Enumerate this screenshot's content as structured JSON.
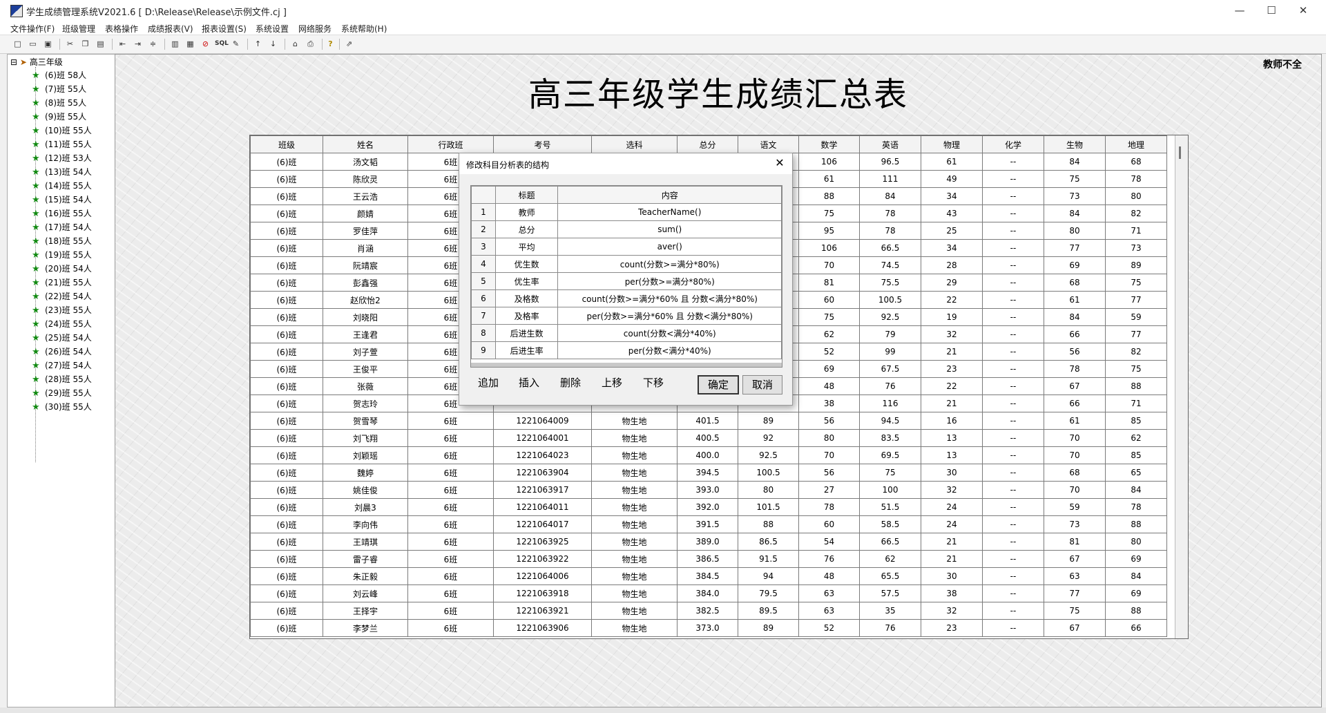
{
  "window": {
    "title": "学生成绩管理系统V2021.6 [ D:\\Release\\Release\\示例文件.cj ]",
    "minimize": "—",
    "maximize": "☐",
    "close": "✕"
  },
  "menu": [
    "文件操作(F)",
    "班级管理",
    "表格操作",
    "成绩报表(V)",
    "报表设置(S)",
    "系统设置",
    "网络服务",
    "系统帮助(H)"
  ],
  "toolbar_icons": [
    "new-icon",
    "open-icon",
    "save-icon",
    "cut-icon",
    "copy-icon",
    "paste-icon",
    "align-left-icon",
    "align-right-icon",
    "merge-icon",
    "chart-icon",
    "grid-icon",
    "delete-icon",
    "sql-icon",
    "pen-icon",
    "sort-asc-icon",
    "sort-desc-icon",
    "home-icon",
    "print-icon",
    "help-icon",
    "export-icon"
  ],
  "tree": {
    "toggle": "⊟",
    "root": "高三年级",
    "items": [
      "(6)班 58人",
      "(7)班 55人",
      "(8)班 55人",
      "(9)班 55人",
      "(10)班 55人",
      "(11)班 55人",
      "(12)班 53人",
      "(13)班 54人",
      "(14)班 55人",
      "(15)班 54人",
      "(16)班 55人",
      "(17)班 54人",
      "(18)班 55人",
      "(19)班 55人",
      "(20)班 54人",
      "(21)班 55人",
      "(22)班 54人",
      "(23)班 55人",
      "(24)班 55人",
      "(25)班 54人",
      "(26)班 54人",
      "(27)班 54人",
      "(28)班 55人",
      "(29)班 55人",
      "(30)班 55人"
    ]
  },
  "report": {
    "title": "高三年级学生成绩汇总表",
    "teacher": "教师不全",
    "columns": [
      "班级",
      "姓名",
      "行政班",
      "考号",
      "选科",
      "总分",
      "语文",
      "数学",
      "英语",
      "物理",
      "化学",
      "生物",
      "地理"
    ],
    "rows": [
      [
        "(6)班",
        "汤文韬",
        "6班",
        "",
        "",
        "",
        "",
        "106",
        "96.5",
        "61",
        "--",
        "84",
        "68"
      ],
      [
        "(6)班",
        "陈欣灵",
        "6班",
        "",
        "",
        "",
        "",
        "61",
        "111",
        "49",
        "--",
        "75",
        "78"
      ],
      [
        "(6)班",
        "王云浩",
        "6班",
        "",
        "",
        "",
        "",
        "88",
        "84",
        "34",
        "--",
        "73",
        "80"
      ],
      [
        "(6)班",
        "颜婧",
        "6班",
        "",
        "",
        "",
        "",
        "75",
        "78",
        "43",
        "--",
        "84",
        "82"
      ],
      [
        "(6)班",
        "罗佳萍",
        "6班",
        "",
        "",
        "",
        "",
        "95",
        "78",
        "25",
        "--",
        "80",
        "71"
      ],
      [
        "(6)班",
        "肖涵",
        "6班",
        "",
        "",
        "",
        "",
        "106",
        "66.5",
        "34",
        "--",
        "77",
        "73"
      ],
      [
        "(6)班",
        "阮靖宸",
        "6班",
        "",
        "",
        "",
        "",
        "70",
        "74.5",
        "28",
        "--",
        "69",
        "89"
      ],
      [
        "(6)班",
        "彭鑫强",
        "6班",
        "",
        "",
        "",
        "",
        "81",
        "75.5",
        "29",
        "--",
        "68",
        "75"
      ],
      [
        "(6)班",
        "赵欣怡2",
        "6班",
        "",
        "",
        "",
        "",
        "60",
        "100.5",
        "22",
        "--",
        "61",
        "77"
      ],
      [
        "(6)班",
        "刘晓阳",
        "6班",
        "",
        "",
        "",
        "",
        "75",
        "92.5",
        "19",
        "--",
        "84",
        "59"
      ],
      [
        "(6)班",
        "王逢君",
        "6班",
        "",
        "",
        "",
        "",
        "62",
        "79",
        "32",
        "--",
        "66",
        "77"
      ],
      [
        "(6)班",
        "刘子萱",
        "6班",
        "",
        "",
        "",
        "",
        "52",
        "99",
        "21",
        "--",
        "56",
        "82"
      ],
      [
        "(6)班",
        "王俊平",
        "6班",
        "",
        "",
        "",
        "",
        "69",
        "67.5",
        "23",
        "--",
        "78",
        "75"
      ],
      [
        "(6)班",
        "张薇",
        "6班",
        "",
        "",
        "",
        "",
        "48",
        "76",
        "22",
        "--",
        "67",
        "88"
      ],
      [
        "(6)班",
        "贺志玲",
        "6班",
        "",
        "",
        "",
        "",
        "38",
        "116",
        "21",
        "--",
        "66",
        "71"
      ],
      [
        "(6)班",
        "贺雪琴",
        "6班",
        "1221064009",
        "物生地",
        "401.5",
        "89",
        "56",
        "94.5",
        "16",
        "--",
        "61",
        "85"
      ],
      [
        "(6)班",
        "刘飞翔",
        "6班",
        "1221064001",
        "物生地",
        "400.5",
        "92",
        "80",
        "83.5",
        "13",
        "--",
        "70",
        "62"
      ],
      [
        "(6)班",
        "刘颖瑶",
        "6班",
        "1221064023",
        "物生地",
        "400.0",
        "92.5",
        "70",
        "69.5",
        "13",
        "--",
        "70",
        "85"
      ],
      [
        "(6)班",
        "魏婷",
        "6班",
        "1221063904",
        "物生地",
        "394.5",
        "100.5",
        "56",
        "75",
        "30",
        "--",
        "68",
        "65"
      ],
      [
        "(6)班",
        "姚佳俊",
        "6班",
        "1221063917",
        "物生地",
        "393.0",
        "80",
        "27",
        "100",
        "32",
        "--",
        "70",
        "84"
      ],
      [
        "(6)班",
        "刘晨3",
        "6班",
        "1221064011",
        "物生地",
        "392.0",
        "101.5",
        "78",
        "51.5",
        "24",
        "--",
        "59",
        "78"
      ],
      [
        "(6)班",
        "李向伟",
        "6班",
        "1221064017",
        "物生地",
        "391.5",
        "88",
        "60",
        "58.5",
        "24",
        "--",
        "73",
        "88"
      ],
      [
        "(6)班",
        "王靖琪",
        "6班",
        "1221063925",
        "物生地",
        "389.0",
        "86.5",
        "54",
        "66.5",
        "21",
        "--",
        "81",
        "80"
      ],
      [
        "(6)班",
        "雷子睿",
        "6班",
        "1221063922",
        "物生地",
        "386.5",
        "91.5",
        "76",
        "62",
        "21",
        "--",
        "67",
        "69"
      ],
      [
        "(6)班",
        "朱正毅",
        "6班",
        "1221064006",
        "物生地",
        "384.5",
        "94",
        "48",
        "65.5",
        "30",
        "--",
        "63",
        "84"
      ],
      [
        "(6)班",
        "刘云峰",
        "6班",
        "1221063918",
        "物生地",
        "384.0",
        "79.5",
        "63",
        "57.5",
        "38",
        "--",
        "77",
        "69"
      ],
      [
        "(6)班",
        "王择宇",
        "6班",
        "1221063921",
        "物生地",
        "382.5",
        "89.5",
        "63",
        "35",
        "32",
        "--",
        "75",
        "88"
      ],
      [
        "(6)班",
        "李梦兰",
        "6班",
        "1221063906",
        "物生地",
        "373.0",
        "89",
        "52",
        "76",
        "23",
        "--",
        "67",
        "66"
      ]
    ]
  },
  "dialog": {
    "title": "修改科目分析表的结构",
    "close": "✕",
    "columns": [
      "",
      "标题",
      "内容"
    ],
    "rows": [
      [
        "1",
        "教师",
        "TeacherName()"
      ],
      [
        "2",
        "总分",
        "sum()"
      ],
      [
        "3",
        "平均",
        "aver()"
      ],
      [
        "4",
        "优生数",
        "count(分数>=满分*80%)"
      ],
      [
        "5",
        "优生率",
        "per(分数>=满分*80%)"
      ],
      [
        "6",
        "及格数",
        "count(分数>=满分*60% 且 分数<满分*80%)"
      ],
      [
        "7",
        "及格率",
        "per(分数>=满分*60% 且 分数<满分*80%)"
      ],
      [
        "8",
        "后进生数",
        "count(分数<满分*40%)"
      ],
      [
        "9",
        "后进生率",
        "per(分数<满分*40%)"
      ]
    ],
    "actions": [
      "追加",
      "插入",
      "删除",
      "上移",
      "下移"
    ],
    "ok": "确定",
    "cancel": "取消"
  }
}
